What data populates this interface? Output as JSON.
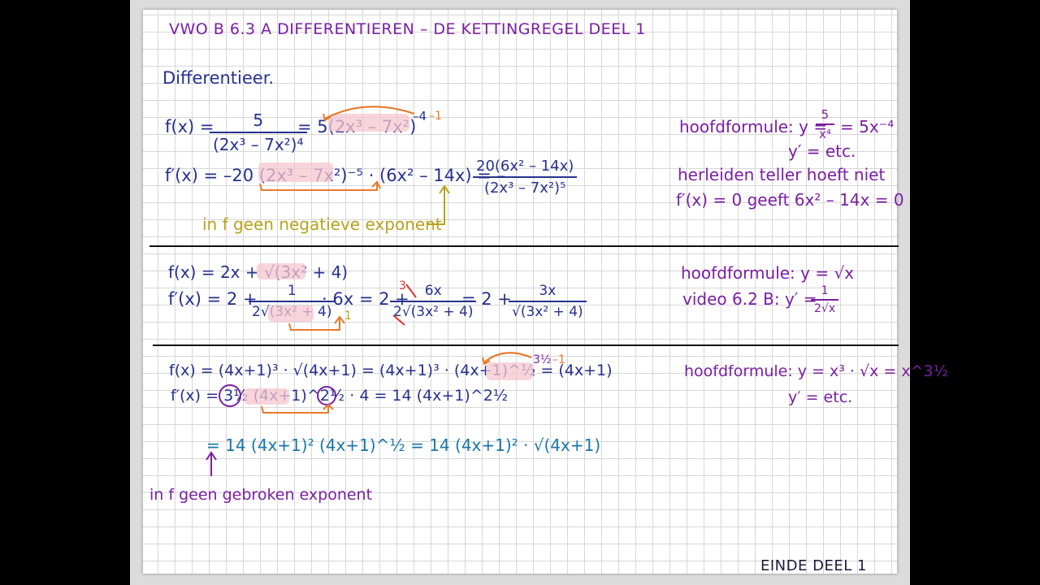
{
  "title": "VWO B 6.3 A   DIFFERENTIEREN – DE KETTINGREGEL   DEEL 1",
  "instruction": "Differentieer.",
  "section1": {
    "f_prefix": "f(x) =",
    "f_num": "5",
    "f_den": "(2x³ – 7x²)⁴",
    "f_rewrite": "= 5(2x³ – 7x²)",
    "f_exp": "–4",
    "f_exp_note": "–1",
    "fp_line": "f′(x) = –20 (2x³ – 7x²)⁻⁵ · (6x² – 14x) = –",
    "fp_num": "20(6x² – 14x)",
    "fp_den": "(2x³ – 7x²)⁵",
    "note": "in f geen negatieve exponent",
    "side_1": "hoofdformule:  y = ",
    "side_1_num": "5",
    "side_1_den": "x⁴",
    "side_1_end": "= 5x⁻⁴",
    "side_2": "y′ = etc.",
    "side_3": "herleiden teller hoeft niet",
    "side_4": "f′(x) = 0 geeft  6x² – 14x = 0"
  },
  "section2": {
    "f_line": "f(x) = 2x + √(3x² + 4)",
    "fp_prefix": "f′(x) = 2 +",
    "fp_num1": "1",
    "fp_den1": "2√(3x² + 4)",
    "fp_mid": "· 6x = 2 +",
    "fp_factor": "1",
    "fp_num2": "6x",
    "fp_strike_num": "3",
    "fp_den2": "2√(3x² + 4)",
    "fp_end": "= 2 +",
    "fp_num3": "3x",
    "fp_den3": "√(3x² + 4)",
    "side_1": "hoofdformule:  y = √x",
    "side_2": "video 6.2 B:  y′ =",
    "side_2_num": "1",
    "side_2_den": "2√x"
  },
  "section3": {
    "f_line": "f(x) = (4x+1)³ · √(4x+1)  = (4x+1)³ · (4x+1)^½ = (4x+1)",
    "f_exp": "3½",
    "f_exp_note": "–1",
    "fp_line": "f′(x) = 3½ (4x+1)^2½ · 4 = 14 (4x+1)^2½",
    "cont_line": "= 14 (4x+1)² (4x+1)^½ = 14 (4x+1)² · √(4x+1)",
    "note": "in f geen gebroken exponent",
    "side_1": "hoofdformule:  y = x³ · √x = x^3½",
    "side_2": "y′ = etc."
  },
  "footer": "EINDE DEEL 1",
  "colors": {
    "purple": "#7a1fa2",
    "dark_blue": "#27318c",
    "cyan": "#1877a8",
    "gold": "#b7a21e",
    "orange": "#e8792b",
    "red": "#e0342a",
    "highlight": "#f6c7cf"
  }
}
